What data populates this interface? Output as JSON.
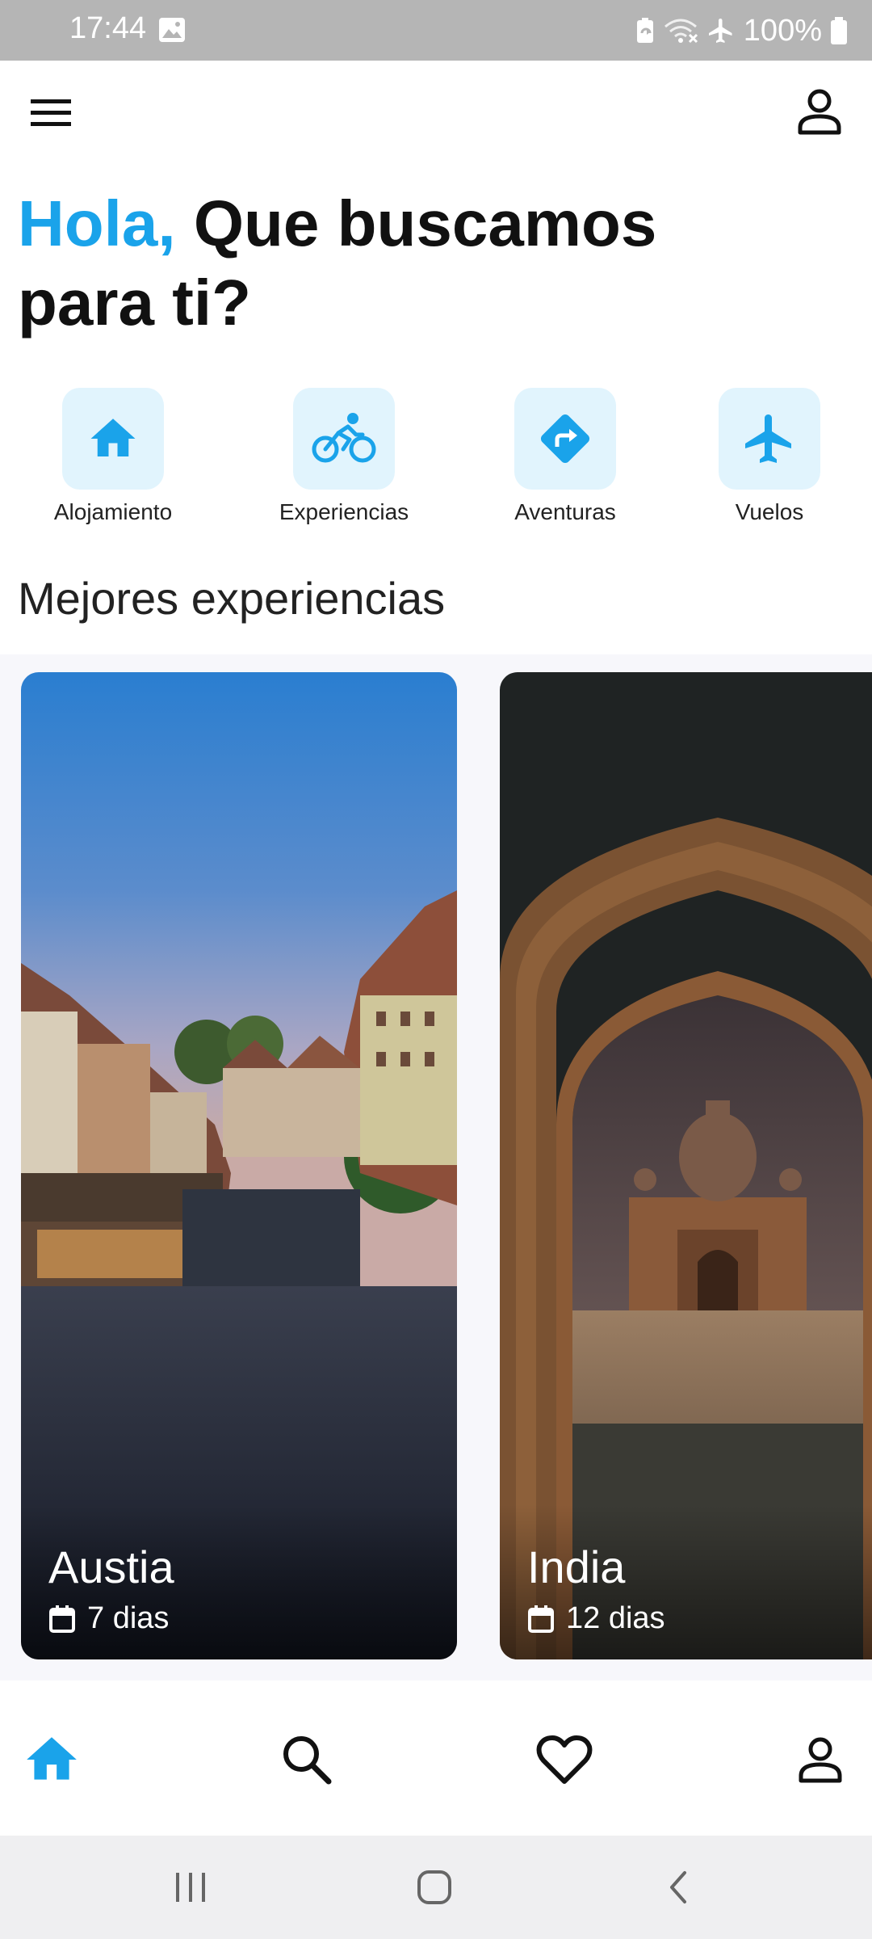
{
  "status_bar": {
    "time": "17:44",
    "battery": "100%",
    "icons": [
      "image-icon",
      "battery-saver-icon",
      "wifi-off-icon",
      "airplane-mode-icon",
      "battery-icon"
    ]
  },
  "header": {
    "greeting_accent": "Hola,",
    "greeting_line1": " Que buscamos",
    "greeting_line2": "para ti?"
  },
  "categories": [
    {
      "label": "Alojamiento",
      "icon": "home-icon"
    },
    {
      "label": "Experiencias",
      "icon": "bicycle-icon"
    },
    {
      "label": "Aventuras",
      "icon": "directions-icon"
    },
    {
      "label": "Vuelos",
      "icon": "airplane-icon"
    }
  ],
  "section": {
    "title": "Mejores experiencias"
  },
  "experiences": [
    {
      "title": "Austia",
      "duration": "7 dias"
    },
    {
      "title": "India",
      "duration": "12 dias"
    }
  ],
  "bottom_nav": {
    "items": [
      "home-icon",
      "search-icon",
      "heart-icon",
      "profile-icon"
    ],
    "active": "home-icon"
  },
  "colors": {
    "accent": "#1aa3ea",
    "tile_bg": "#e1f4fd",
    "status_bar": "#b5b5b5"
  }
}
